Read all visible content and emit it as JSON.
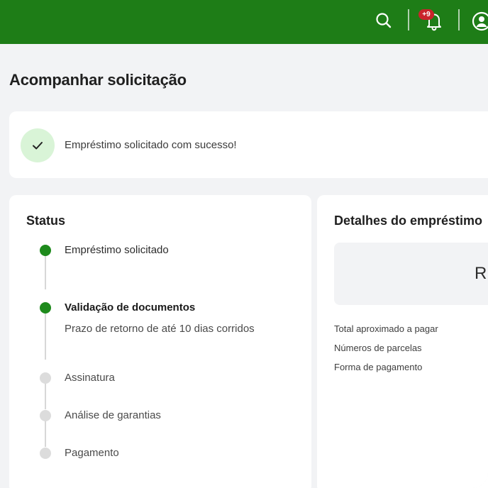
{
  "header": {
    "bg_color": "#1e7d17",
    "notifications_badge": "+9",
    "icons": [
      "search-icon",
      "bell-icon",
      "user-icon"
    ]
  },
  "page": {
    "title": "Acompanhar solicitação"
  },
  "alert": {
    "message": "Empréstimo solicitado com sucesso!",
    "icon": "check-icon",
    "icon_bg": "#d9f4d7"
  },
  "status_card": {
    "title": "Status",
    "steps": [
      {
        "label": "Empréstimo solicitado",
        "state": "done"
      },
      {
        "label": "Validação de documentos",
        "state": "current",
        "sub": "Prazo de retorno de até 10 dias corridos"
      },
      {
        "label": "Assinatura",
        "state": "pending"
      },
      {
        "label": "Análise de garantias",
        "state": "pending"
      },
      {
        "label": "Pagamento",
        "state": "pending"
      }
    ],
    "done_color": "#1e8a1c",
    "pending_color": "#dcdcdc"
  },
  "details_card": {
    "title": "Detalhes do empréstimo",
    "amount_partial": "R",
    "rows": [
      "Total aproximado a pagar",
      "Números de parcelas",
      "Forma de pagamento"
    ]
  }
}
